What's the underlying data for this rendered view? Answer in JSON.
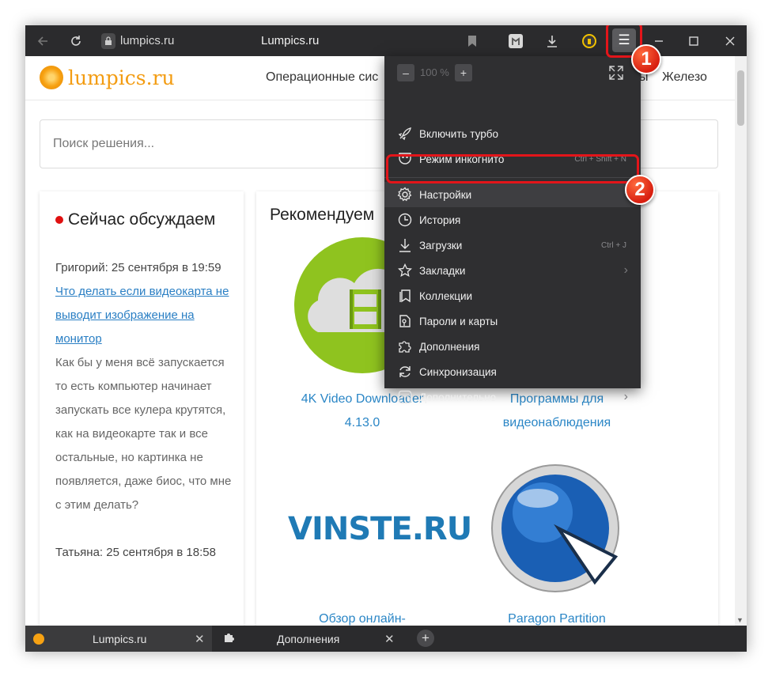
{
  "browser": {
    "address": "lumpics.ru",
    "page_title": "Lumpics.ru",
    "menu_icon": "☰"
  },
  "site": {
    "logo_text": "lumpics.ru",
    "nav": [
      "Операционные сис",
      "ы",
      "Железо"
    ],
    "search_placeholder": "Поиск решения..."
  },
  "discussion": {
    "title": "Сейчас обсуждаем",
    "author1": "Григорий: 25 сентября в 19:59",
    "link1": "Что делать если видеокарта не выводит изображение на монитор",
    "comment1": "Как бы у меня всё запускается то есть компьютер начинает запускать все кулера крутятся, как на видеокарте так и все остальные, но картинка не появляется, даже биос, что мне с этим делать?",
    "author2": "Татьяна: 25 сентября в 18:58"
  },
  "recommended": {
    "title": "Рекомендуем",
    "items": [
      {
        "caption": "4K Video Downloader 4.13.0"
      },
      {
        "caption": "Программы для видеонаблюдения"
      },
      {
        "caption": "Обзор онлайн-",
        "logo": "VINSTE.RU"
      },
      {
        "caption": "Paragon Partition"
      }
    ]
  },
  "menu": {
    "zoom_minus": "–",
    "zoom_value": "100 %",
    "zoom_plus": "+",
    "items": [
      {
        "label": "Включить турбо",
        "shortcut": ""
      },
      {
        "label": "Режим инкогнито",
        "shortcut": "Ctrl + Shift + N"
      },
      {
        "label": "Настройки",
        "shortcut": ""
      },
      {
        "label": "История",
        "shortcut": ""
      },
      {
        "label": "Загрузки",
        "shortcut": "Ctrl + J"
      },
      {
        "label": "Закладки",
        "shortcut": ""
      },
      {
        "label": "Коллекции",
        "shortcut": ""
      },
      {
        "label": "Пароли и карты",
        "shortcut": ""
      },
      {
        "label": "Дополнения",
        "shortcut": ""
      },
      {
        "label": "Синхронизация",
        "shortcut": ""
      },
      {
        "label": "Дополнительно",
        "shortcut": ""
      }
    ]
  },
  "annotations": {
    "badge1": "1",
    "badge2": "2"
  },
  "tabs": [
    {
      "label": "Lumpics.ru"
    },
    {
      "label": "Дополнения"
    }
  ],
  "colors": {
    "accent_red": "#e3151a",
    "link_blue": "#2a7fc4",
    "logo_orange": "#f39c12",
    "chrome_dark": "#2b2b2d"
  }
}
